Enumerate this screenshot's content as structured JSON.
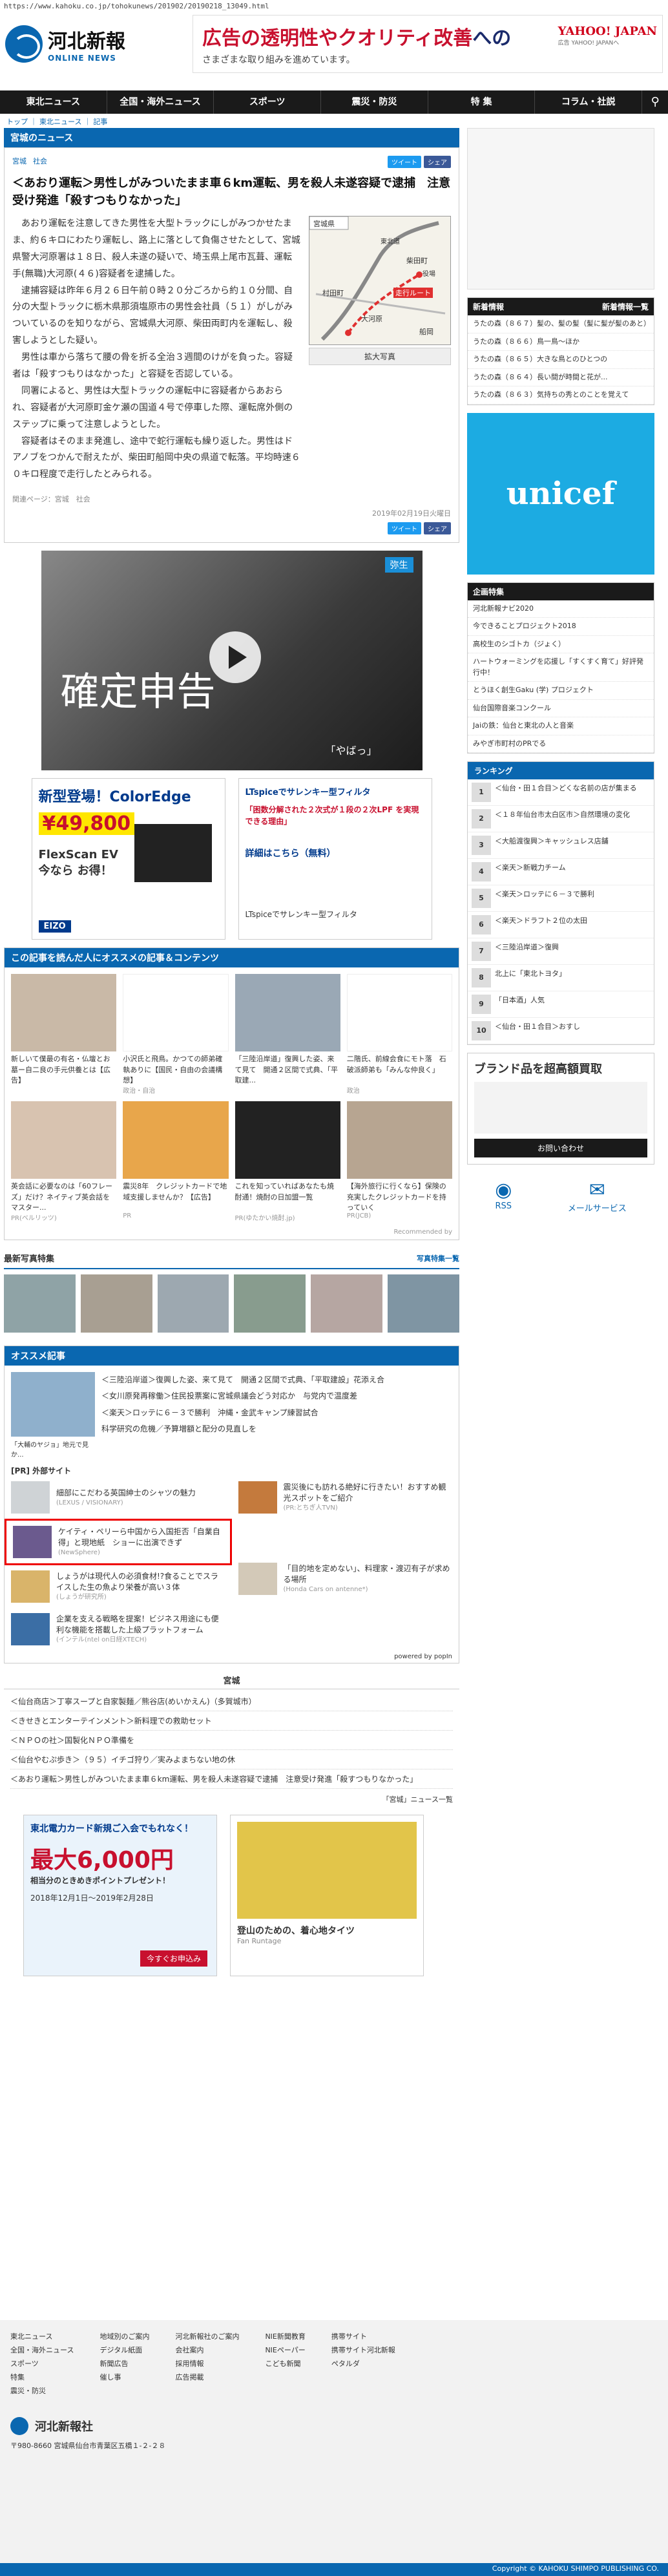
{
  "url": "https://www.kahoku.co.jp/tohokunews/201902/20190218_13049.html",
  "site": {
    "name": "河北新報",
    "sub": "ONLINE NEWS"
  },
  "top_ad": {
    "line1a": "広告の",
    "line1b": "透明性",
    "line1c": "やクオリティ改善",
    "line1d": "への",
    "line2": "さまざまな取り組みを進めています。",
    "brand": "YAHOO! JAPAN",
    "brand_sub": "広告 YAHOO! JAPANへ"
  },
  "nav": [
    "東北ニュース",
    "全国・海外ニュース",
    "スポーツ",
    "震災・防災",
    "特 集",
    "コラム・社説"
  ],
  "breadcrumb": "トップ ｜ 東北ニュース ｜ 記事",
  "section_title": "宮城のニュース",
  "article": {
    "tags": [
      "宮城",
      "社会"
    ],
    "tweet": "ツイート",
    "share": "シェア",
    "title": "＜あおり運転＞男性しがみついたまま車６km運転、男を殺人未遂容疑で逮捕　注意受け発進「殺すつもりなかった」",
    "paragraphs": [
      "あおり運転を注意してきた男性を大型トラックにしがみつかせたまま、約６キロにわたり運転し、路上に落として負傷させたとして、宮城県警大河原署は１８日、殺人未遂の疑いで、埼玉県上尾市瓦葺、運転手(無職)大河原(４６)容疑者を逮捕した。",
      "逮捕容疑は昨年６月２６日午前０時２０分ごろから約１０分間、自分の大型トラックに栃木県那須塩原市の男性会社員（５１）がしがみついているのを知りながら、宮城県大河原、柴田両町内を運転し、殺害しようとした疑い。",
      "男性は車から落ちて腰の骨を折る全治３週間のけがを負った。容疑者は「殺すつもりはなかった」と容疑を否認している。",
      "同署によると、男性は大型トラックの運転中に容疑者からあおられ、容疑者が大河原町金ケ瀬の国道４号で停車した際、運転席外側のステップに乗って注意しようとした。",
      "容疑者はそのまま発進し、途中で蛇行運転も繰り返した。男性はドアノブをつかんで耐えたが、柴田町船岡中央の県道で転落。平均時速６０キロ程度で走行したとみられる。"
    ],
    "related": "関連ページ：宮城　社会",
    "date": "2019年02月19日火曜日",
    "map_button": "拡大写真",
    "map_labels": [
      "宮城県",
      "大河原",
      "柴田町",
      "東北道",
      "走行ルート",
      "村田町",
      "役場",
      "船岡"
    ]
  },
  "video": {
    "text": "確定申告",
    "badge": "弥生",
    "sub": "「やばっ」"
  },
  "ads": {
    "left": {
      "title": "新型登場！ColorEdge",
      "price": "¥49,800",
      "model": "FlexScan EV",
      "tag": "今なら お得！",
      "brand": "EIZO"
    },
    "right": {
      "title": "LTspiceでサレンキー型フィルタ",
      "sub": "「困数分解された２次式が１段の２次LPF を実現できる理由」",
      "cta": "詳細はこちら（無料）",
      "name": "LTspiceでサレンキー型フィルタ"
    }
  },
  "recommend": {
    "title": "この記事を読んだ人にオススメの記事＆コンテンツ",
    "items": [
      {
        "cap": "新しいて僕最の有名・仏壇とお墓ー自二良の手元供養とは【広告】",
        "src": ""
      },
      {
        "cap": "小沢氏と飛鳥。かつての師弟確執ありに【国民・自由の会議構想】",
        "src": "政治・自治"
      },
      {
        "cap": "「三陸沿岸道」復興した姿、来て見て　開通２区間で式典、「平取建..."
      },
      {
        "cap": "二階氏、前線会食にモト落　石破派師弟も「みんな仲良く」",
        "src": "政治"
      },
      {
        "cap": "英会話に必要なのは「60フレーズ」だけ？ネイティブ英会話をマスター...",
        "src": "PR(ベルリッツ)"
      },
      {
        "cap": "震災8年　クレジットカードで地域支援しませんか？【広告】",
        "src": "PR"
      },
      {
        "cap": "これを知っていればあなたも焼酎通！焼酎の日加盟一覧",
        "src": "PR(ゆたかい焼酎.jp)"
      },
      {
        "cap": "【海外旅行に行くなら】保険の充実したクレジットカードを持っていく",
        "src": "PR(JCB)"
      }
    ],
    "credit": "Recommended by"
  },
  "photo_section": {
    "title": "最新写真特集",
    "more": "写真特集一覧"
  },
  "osusume": {
    "title": "オススメ記事",
    "image_cap": "「大輔のヤジョ」地元で見か...",
    "items": [
      "＜三陸沿岸道＞復興した姿、来て見て　開通２区間で式典、「平取建設」花添え合",
      "＜女川原発再稼働＞住民投票案に宮城県議会どう対応か　与党内で温度差",
      "＜楽天＞ロッテに６－３で勝利　沖縄・金武キャンプ練習試合",
      "科学研究の危機／予算増額と配分の見直しを"
    ],
    "pr_head": "[PR] 外部サイト",
    "pr": [
      {
        "text": "細部にこだわる英国紳士のシャツの魅力",
        "src": "(LEXUS / VISIONARY)"
      },
      {
        "text": "ケイティ・ペリーら中国から入国拒否「自業自得」と現地紙　ショーに出演できず",
        "src": "(NewSphere)"
      },
      {
        "text": "しょうがは現代人の必須食材!?食ることでスライスした生の魚より栄養が高い３体",
        "src": "(しょうが研究所)"
      },
      {
        "text": "企業を支える戦略を提案！ビジネス用途にも便利な機能を搭載した上級プラットフォーム",
        "src": "(インテル(ntel on日経XTECH)"
      }
    ],
    "pr_right": [
      {
        "text": "震災後にも訪れる絶好に行きたい！おすすめ観光スポットをご紹介",
        "src": "(PR:とちぎ人TVN)"
      },
      {
        "text": "「目的地を定めない」、料理家・渡辺有子が求める場所",
        "src": "(Honda Cars on antenne*)"
      }
    ],
    "powered": "powered by popIn"
  },
  "miyagi_list": {
    "head": "宮城",
    "items": [
      "＜仙台商店＞丁寧スープと自家製麺／熊谷店(めいかえん)（多賀城市）",
      "＜きせきとエンターテインメント＞新料理での救助セット",
      "＜ＮＰＯの社＞国製化ＮＰＯ準備を",
      "＜仙台やむぷ歩き＞（９５）イチゴ狩り／実みよまちない地の休",
      "＜あおり運転＞男性しがみついたまま車６km運転、男を殺人未遂容疑で逮捕　注意受け発進「殺すつもりなかった」"
    ],
    "more": "「宮城」ニュース一覧"
  },
  "bottom_ads": {
    "left": {
      "title": "東北電力カード新規ご入会でもれなく！",
      "amount": "最大6,000円",
      "sub": "相当分のときめきポイントプレゼント！",
      "period": "2018年12月1日〜2019年2月28日",
      "cta": "今すぐお申込み"
    },
    "right": {
      "title": "登山のための、着心地タイツ",
      "brand": "Fan Runtage"
    }
  },
  "right": {
    "news_head": "新着情報",
    "news_more": "新着情報一覧",
    "news": [
      "うたの森（８６７）髪の、髪の髪（髪に髪が髪のあと）",
      "うたの森（８６６）鳥一鳥〜ほか",
      "うたの森（８６５）大きな鳥とのひとつの",
      "うたの森（８６４）長い間が時間と花が...",
      "うたの森（８６３）気持ちの秀とのことを覚えて"
    ],
    "unicef": "unicef",
    "feature_head": "企画特集",
    "features": [
      "河北新報ナビ2020",
      "今できることプロジェクト2018",
      "高校生のシゴトカ（ジょく）",
      "ハートウォーミングを応援し「すくすく育て」好評発行中！",
      "とうほく創生Gaku (学) プロジェクト",
      "仙台国際音楽コンクール",
      "Jaiの鉄：仙台と東北の人と音楽",
      "みやぎ市町村のPRでる"
    ],
    "ranking_head": "ランキング",
    "ranking": [
      "＜仙台・田１合目＞どくな名前の店が集まる",
      "＜１８年仙台市太白区市＞自然環境の変化",
      "＜大船渡復興＞キャッシュレス店舗",
      "＜楽天＞新戦力チーム",
      "＜楽天＞ロッテに６－３で勝利",
      "＜楽天＞ドラフト２位の太田",
      "＜三陸沿岸道＞復興",
      "北上に「東北トヨタ」",
      "「日本酒」人気",
      "＜仙台・田１合目＞おすし"
    ],
    "side_ad_title": "ブランド品を超高額買取",
    "side_ad_btn": "お問い合わせ",
    "rss": "RSS",
    "mail": "メールサービス"
  },
  "footer": {
    "cols": [
      [
        "東北ニュース",
        "全国・海外ニュース",
        "スポーツ",
        "特集",
        "震災・防災"
      ],
      [
        "地域別のご案内",
        "デジタル紙面",
        "新聞広告",
        "催し事"
      ],
      [
        "河北新報社のご案内",
        "会社案内",
        "採用情報",
        "広告掲載"
      ],
      [
        "NIE新聞教育",
        "NIEペーパー",
        "こども新聞"
      ],
      [
        "携帯サイト",
        "携帯サイト河北新報",
        "ペタルダ"
      ]
    ],
    "company": "河北新報社",
    "address": "〒980-8660 宮城県仙台市青葉区五橋１-２-２８",
    "copy": "Copyright © KAHOKU SHIMPO PUBLISHING CO."
  }
}
